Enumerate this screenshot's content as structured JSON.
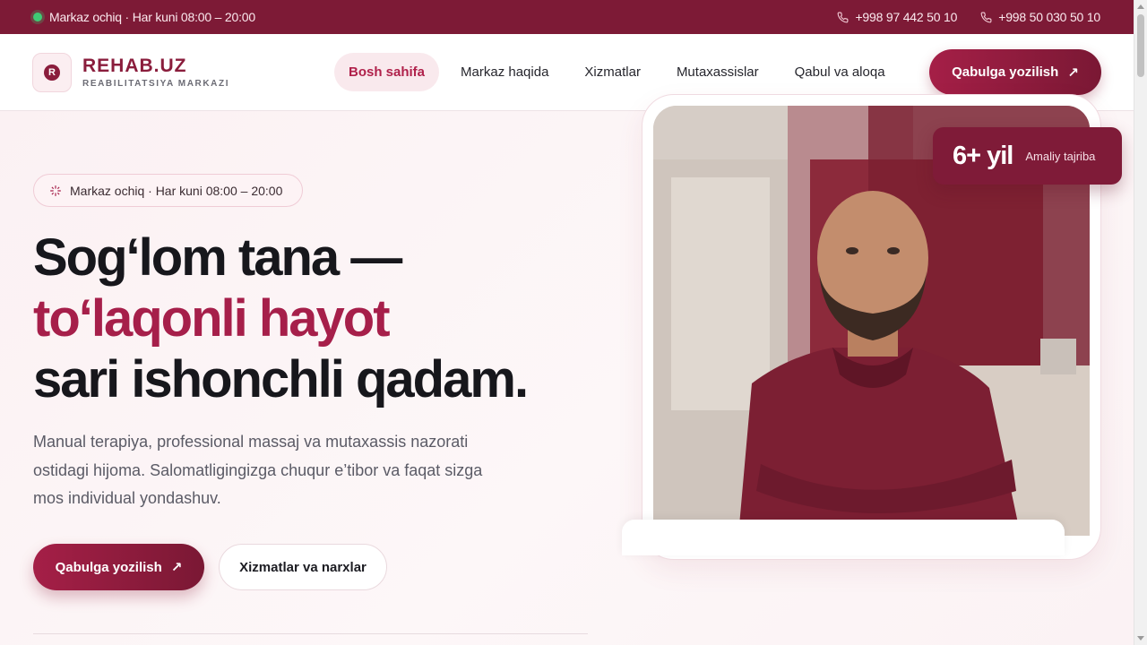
{
  "topbar": {
    "status": "Markaz ochiq · Har kuni 08:00 – 20:00",
    "phone_1": "+998 97 442 50 10",
    "phone_2": "+998 50 030 50 10"
  },
  "header": {
    "logo_name": "REHAB.UZ",
    "logo_sub": "REABILITATSIYA MARKAZI",
    "nav": [
      "Bosh sahifa",
      "Markaz haqida",
      "Xizmatlar",
      "Mutaxassislar",
      "Qabul va aloqa"
    ],
    "cta": "Qabulga yozilish"
  },
  "hero": {
    "pill": "Markaz ochiq · Har kuni 08:00 – 20:00",
    "title_line1": "Sogʻlom tana —",
    "title_line2": "toʻlaqonli hayot",
    "title_line3": "sari ishonchli qadam.",
    "lead": "Manual terapiya, professional massaj va mutaxassis nazorati ostidagi hijoma. Salomatligingizga chuqur e’tibor va faqat sizga mos individual yondashuv.",
    "btn_primary": "Qabulga yozilish",
    "btn_secondary": "Xizmatlar va narxlar",
    "stat_value": "6+ yil",
    "stat_label": "Amaliy tajriba"
  },
  "colors": {
    "brand": "#7d1a36",
    "accent": "#a61f4a",
    "status_online": "#3fcb74"
  },
  "icons": {
    "status": "status-dot-icon",
    "phone": "phone-icon",
    "sparkle": "sparkle-icon",
    "arrow": "arrow-up-right-icon",
    "logo": "logo-mark-icon"
  }
}
